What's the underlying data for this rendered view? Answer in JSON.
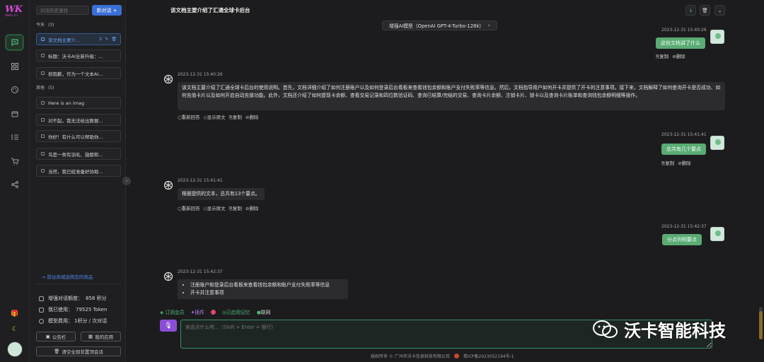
{
  "app": {
    "logo_text": "WK",
    "logo_version": "WoKa 4.1"
  },
  "sidebar": {
    "search_placeholder": "对话历史查找",
    "new_chat_label": "新对话",
    "group_today": "今天",
    "group_today_count": "(3)",
    "group_earlier": "其他",
    "group_earlier_count": "(5)",
    "conversations": [
      {
        "title": "该文档主要介..."
      },
      {
        "title": "标题：沃卡AI全新升级：..."
      },
      {
        "title": "很抱歉，作为一个文本AI..."
      },
      {
        "title": "Here is an imag"
      },
      {
        "title": "对不起，我无法给出数据..."
      },
      {
        "title": "你好！有什么可以帮助你..."
      },
      {
        "title": "鸟是一类有羽毛、翅膀和..."
      },
      {
        "title": "当然，我已经准备好协助..."
      }
    ],
    "store_link": "前往商城选购您的商品",
    "stats": [
      {
        "label": "增强对话额度：",
        "value": "858 积分"
      },
      {
        "label": "我已使用：",
        "value": "79525 Token"
      },
      {
        "label": "模型费用：",
        "value": "1积分 / 次对话"
      }
    ],
    "announcement_button": "公告栏",
    "my_apps_button": "我的应用",
    "clear_button": "清空全部非置顶会话"
  },
  "header": {
    "title": "该文档主要介绍了汇通全球卡后台",
    "model_label": "增强AI模型（OpenAI GPT-4-Turbo-128k）"
  },
  "messages": [
    {
      "role": "user",
      "time": "2023-12-31 15:40:26",
      "text": "这份文档讲了什么",
      "actions": [
        "复制",
        "删除"
      ]
    },
    {
      "role": "ai",
      "time": "2023-12-31 15:40:26",
      "text": "该文档主要介绍了汇通全球卡后台的使用说明。首先，文档详细介绍了如何注册账户以及如何登录后台看板来查看钱包余额和账户支付失败率等信息。然后，文档指导用户如何开卡并提供了开卡的注意事项。接下来，文档解释了如何查询开卡是否成功、如何充值卡片以及如何开启自动充值功能。此外，文档还介绍了如何提现卡余额、查看交易记录和四位数验证码、查询已结算/完结的交易、查询卡片余额、注销卡片、锁卡以及查询卡片账单和查询钱包余额明细等操作。",
      "actions": [
        "重新回答",
        "显示原文",
        "复制",
        "删除"
      ]
    },
    {
      "role": "user",
      "time": "2023-12-31 15:41:41",
      "text": "总共有几个要点",
      "actions": [
        "复制",
        "删除"
      ]
    },
    {
      "role": "ai",
      "time": "2023-12-31 15:41:41",
      "text": "根据提供的文本，总共有13个要点。",
      "actions": [
        "重新回答",
        "显示原文",
        "复制",
        "删除"
      ]
    },
    {
      "role": "user",
      "time": "2023-12-31 15:42:37",
      "text": "分点列明要点",
      "actions": []
    },
    {
      "role": "ai",
      "time": "2023-12-31 15:42:37",
      "list": [
        "注册账户和登录后台看板来查看钱包余额和账户支付失败率等信息",
        "开卡并注意事项"
      ],
      "actions": []
    }
  ],
  "toolbar": {
    "member": "订阅会员",
    "plugin": "插件",
    "memory": "已启用记忆",
    "network": "联网"
  },
  "input": {
    "placeholder": "来说点什么吧...（Shift + Enter = 换行）"
  },
  "footer": {
    "copyright": "版权所有 © 广州市沃卡信息科技有限公司",
    "icp": "粤ICP备2023052194号-1"
  },
  "watermark": {
    "text": "沃卡智能科技"
  }
}
